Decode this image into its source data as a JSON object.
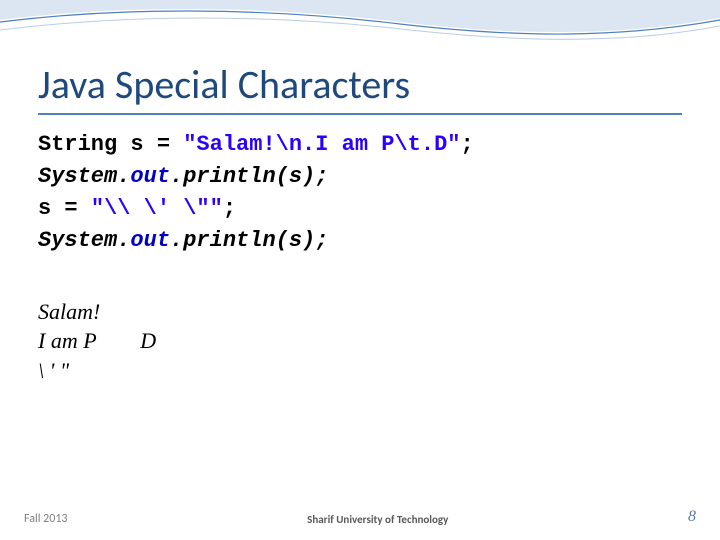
{
  "title": "Java Special Characters",
  "code": {
    "line1_a": "String s = ",
    "line1_str": "\"Salam!\\n.I am P\\t.D\"",
    "line1_b": ";",
    "line2_a": "System.",
    "line2_out": "out",
    "line2_b": ".println(s);",
    "line3_a": "s = ",
    "line3_str": "\"\\\\ \\' \\\"\"",
    "line3_b": ";",
    "line4_a": "System.",
    "line4_out": "out",
    "line4_b": ".println(s);"
  },
  "output": {
    "l1": "Salam!",
    "l2": "I am P        D",
    "l3": "\\ ' \""
  },
  "footer": {
    "left": "Fall 2013",
    "center": "Sharif University of Technology",
    "right": "8"
  }
}
